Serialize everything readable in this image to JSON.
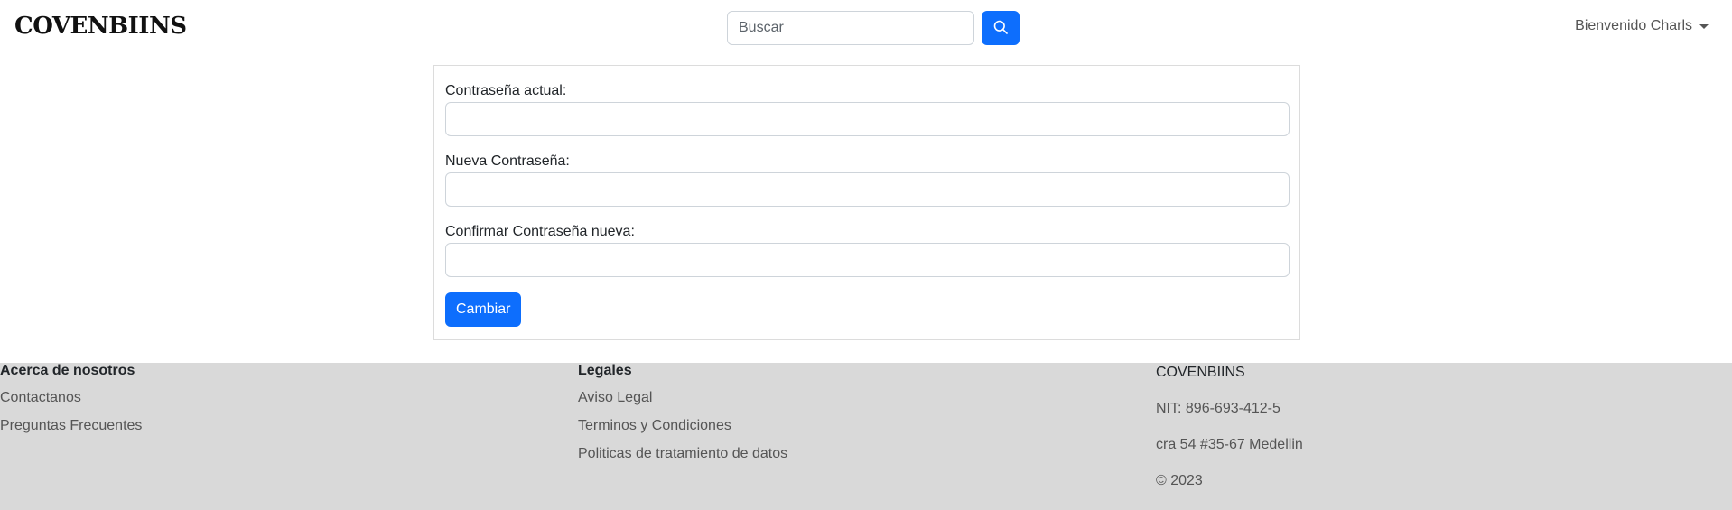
{
  "header": {
    "brand": "COVENBIINS",
    "search": {
      "placeholder": "Buscar",
      "value": ""
    },
    "search_icon": "search-icon",
    "user_menu": "Bienvenido Charls"
  },
  "form": {
    "fields": [
      {
        "label": "Contraseña actual:",
        "value": ""
      },
      {
        "label": "Nueva Contraseña:",
        "value": ""
      },
      {
        "label": "Confirmar Contraseña nueva:",
        "value": ""
      }
    ],
    "submit_label": "Cambiar"
  },
  "footer": {
    "about": {
      "heading": "Acerca de nosotros",
      "links": [
        "Contactanos",
        "Preguntas Frecuentes"
      ]
    },
    "legal": {
      "heading": "Legales",
      "links": [
        "Aviso Legal",
        "Terminos y Condiciones",
        "Politicas de tratamiento de datos"
      ]
    },
    "company": {
      "name": "COVENBIINS",
      "nit": "NIT: 896-693-412-5",
      "address": "cra 54 #35-67 Medellin",
      "copyright": "© 2023"
    }
  },
  "colors": {
    "primary": "#0d6efd",
    "footer_bg": "#d9d9d9",
    "card_border": "#dcdcdc"
  }
}
